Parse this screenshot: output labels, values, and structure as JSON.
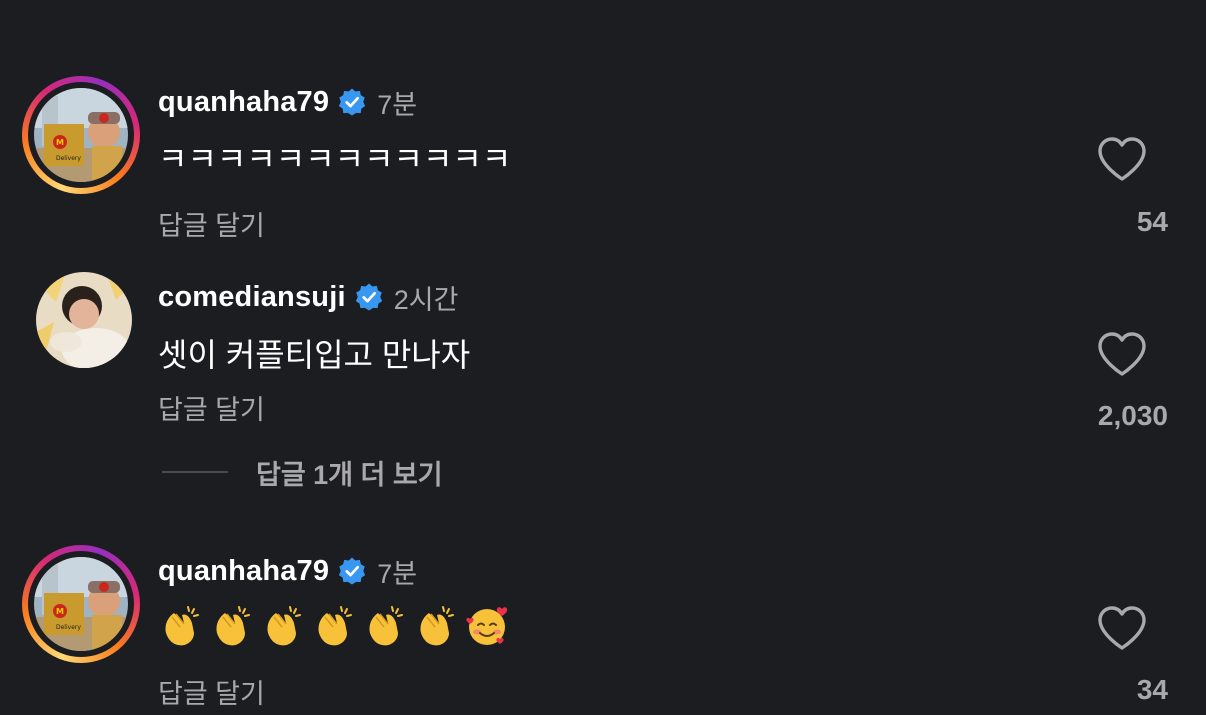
{
  "comments": [
    {
      "username": "quanhaha79",
      "time": "7분",
      "text": "ㅋㅋㅋㅋㅋㅋㅋㅋㅋㅋㅋㅋ",
      "reply_label": "답글 달기",
      "likes": "54",
      "avatar_icon": "mcdonalds-delivery-avatar",
      "story_ring": true
    },
    {
      "username": "comediansuji",
      "time": "2시간",
      "text": "셋이 커플티입고 만나자",
      "reply_label": "답글 달기",
      "likes": "2,030",
      "avatar_icon": "woman-photo-avatar",
      "story_ring": false,
      "more_replies": "답글 1개 더 보기"
    },
    {
      "username": "quanhaha79",
      "time": "7분",
      "emojis": [
        "clapping-hands",
        "clapping-hands",
        "clapping-hands",
        "clapping-hands",
        "clapping-hands",
        "clapping-hands",
        "smiling-face-with-hearts"
      ],
      "reply_label": "답글 달기",
      "likes": "34",
      "avatar_icon": "mcdonalds-delivery-avatar",
      "story_ring": true
    }
  ],
  "colors": {
    "background": "#1c1d21",
    "text_primary": "#ffffff",
    "text_secondary": "#a8a8ad",
    "verified": "#3897f0"
  }
}
